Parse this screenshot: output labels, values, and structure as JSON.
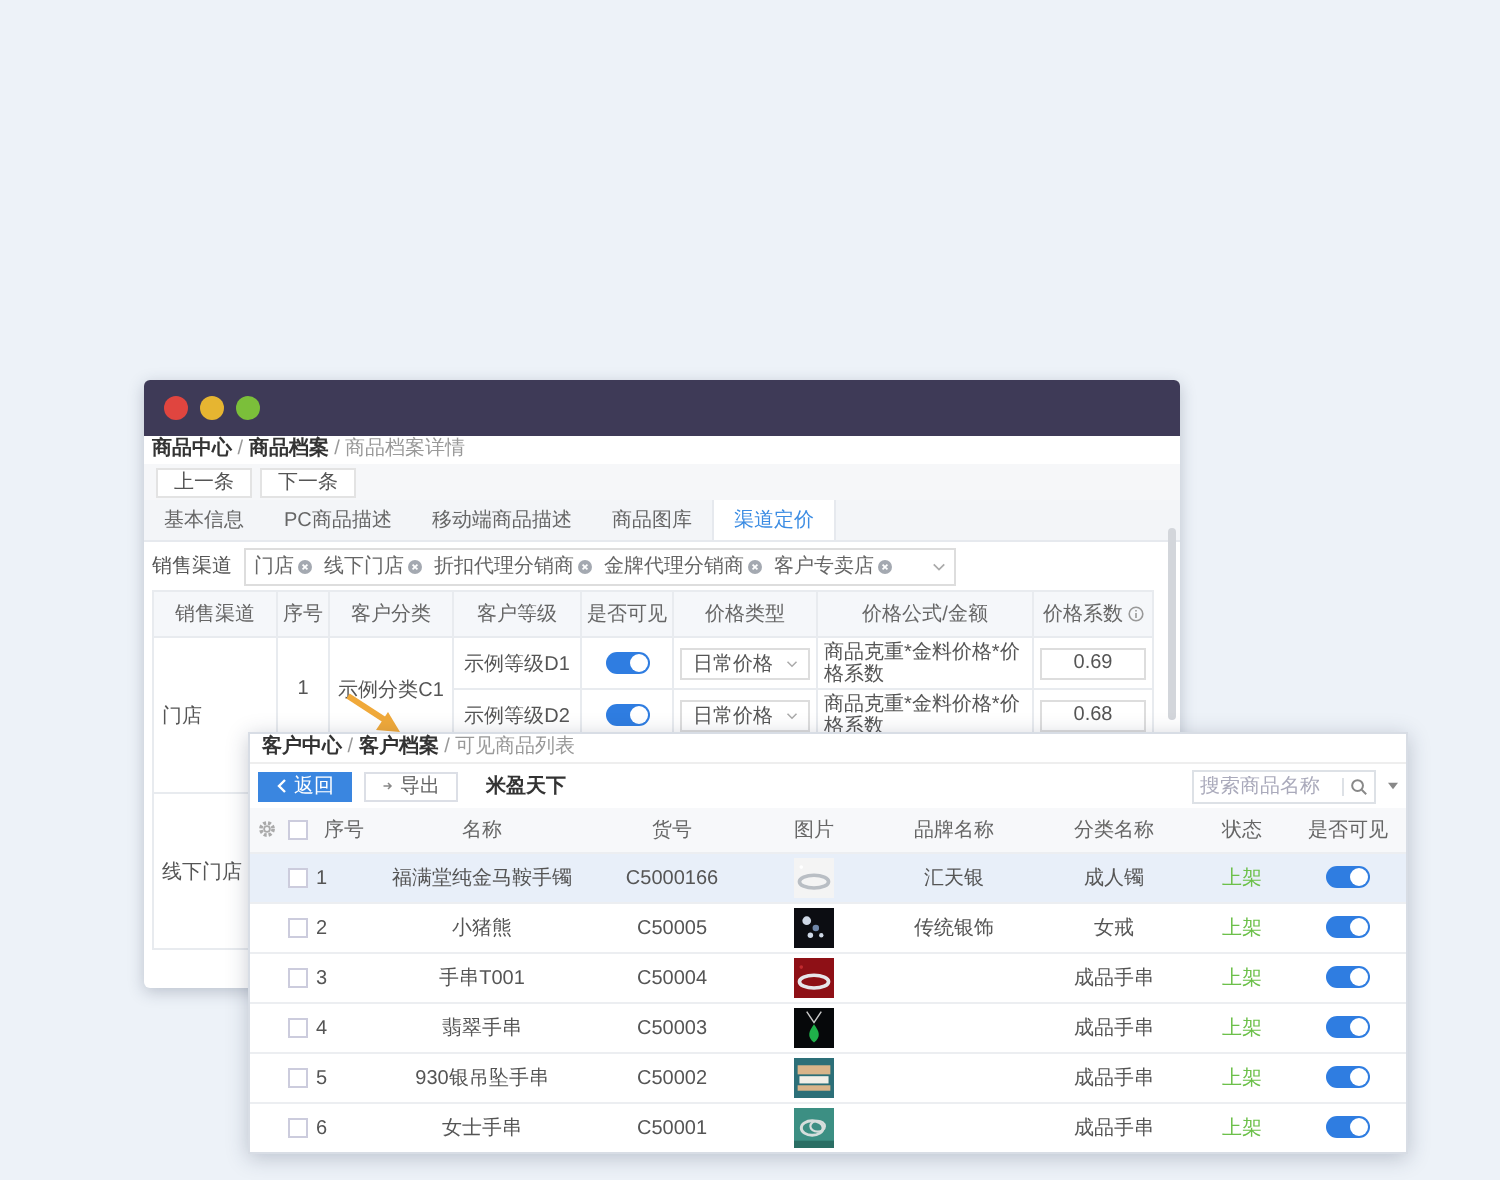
{
  "back_window": {
    "breadcrumb": "**商品中心** / **商品档案** / 商品档案详情",
    "nav_buttons": [
      "上一条",
      "下一条"
    ],
    "tabs": [
      {
        "label": "基本信息",
        "selected": false
      },
      {
        "label": "PC商品描述",
        "selected": false
      },
      {
        "label": "移动端商品描述",
        "selected": false
      },
      {
        "label": "商品图库",
        "selected": false
      },
      {
        "label": "渠道定价",
        "selected": true
      }
    ],
    "channel_filter": {
      "label": "销售渠道",
      "tags": [
        "门店",
        "线下门店",
        "折扣代理分销商",
        "金牌代理分销商",
        "客户专卖店"
      ]
    },
    "table": {
      "columns": [
        "销售渠道",
        "序号",
        "客户分类",
        "客户等级",
        "是否可见",
        "价格类型",
        "价格公式/金额",
        "价格系数"
      ],
      "channels": [
        {
          "name": "门店",
          "groups": [
            {
              "index": "1",
              "category": "示例分类C1",
              "levels": [
                {
                  "level": "示例等级D1",
                  "visible": true,
                  "price_type": "日常价格",
                  "formula": "商品克重*金料价格*价格系数",
                  "coefficient": "0.69"
                },
                {
                  "level": "示例等级D2",
                  "visible": true,
                  "price_type": "日常价格",
                  "formula": "商品克重*金料价格*价格系数",
                  "coefficient": "0.68"
                }
              ]
            }
          ]
        },
        {
          "name": "线下门店"
        }
      ]
    }
  },
  "front_window": {
    "breadcrumb": "**客户中心** / **客户档案** / 可见商品列表",
    "buttons": [
      {
        "label": "返回",
        "kind": "primary"
      },
      {
        "label": "导出",
        "kind": "default"
      }
    ],
    "title": "米盈天下",
    "search": {
      "placeholder": "搜索商品名称"
    },
    "table": {
      "select_all": {
        "checked": false
      },
      "columns": [
        "序号",
        "名称",
        "货号",
        "图片",
        "品牌名称",
        "分类名称",
        "状态",
        "是否可见"
      ],
      "rows": [
        {
          "selected": true,
          "checked": false,
          "index": "1",
          "name": "福满堂纯金马鞍手镯",
          "sku": "C5000166",
          "brand": "汇天银",
          "category": "成人镯",
          "status": "上架",
          "visible": true
        },
        {
          "selected": false,
          "checked": false,
          "index": "2",
          "name": "小猪熊",
          "sku": "C50005",
          "brand": "传统银饰",
          "category": "女戒",
          "status": "上架",
          "visible": true
        },
        {
          "selected": false,
          "checked": false,
          "index": "3",
          "name": "手串T001",
          "sku": "C50004",
          "category": "成品手串",
          "status": "上架",
          "visible": true
        },
        {
          "selected": false,
          "checked": false,
          "index": "4",
          "name": "翡翠手串",
          "sku": "C50003",
          "category": "成品手串",
          "status": "上架",
          "visible": true
        },
        {
          "selected": false,
          "checked": false,
          "index": "5",
          "name": "930银吊坠手串",
          "sku": "C50002",
          "category": "成品手串",
          "status": "上架",
          "visible": true
        },
        {
          "selected": false,
          "checked": false,
          "index": "6",
          "name": "女士手串",
          "sku": "C50001",
          "category": "成品手串",
          "status": "上架",
          "visible": true
        }
      ]
    }
  }
}
